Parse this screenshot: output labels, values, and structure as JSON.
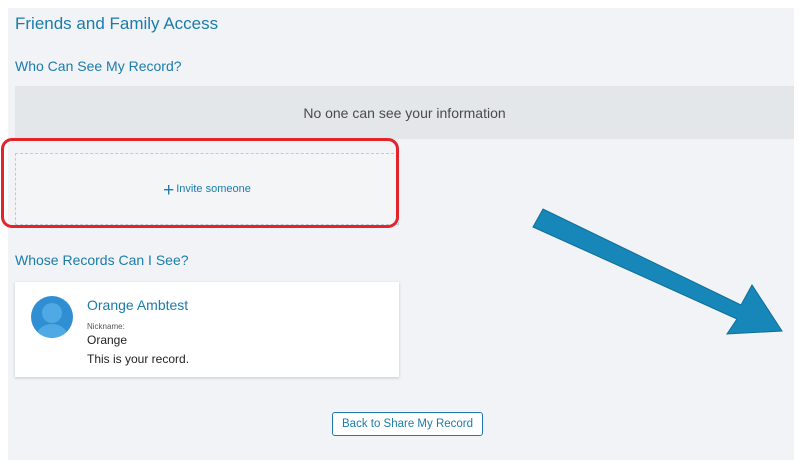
{
  "page": {
    "title": "Friends and Family Access"
  },
  "who_can_see": {
    "heading": "Who Can See My Record?",
    "empty_text": "No one can see your information",
    "invite_icon": "plus-icon",
    "invite_glyph": "+",
    "invite_label": "Invite someone"
  },
  "whose_records": {
    "heading": "Whose Records Can I See?",
    "records": [
      {
        "name": "Orange Ambtest",
        "nickname_label": "Nickname:",
        "nickname": "Orange",
        "note": "This is your record.",
        "avatar_icon": "user-avatar-icon"
      }
    ]
  },
  "footer": {
    "back_label": "Back to Share My Record"
  },
  "colors": {
    "accent": "#1b7cab",
    "highlight_ring": "#e3252b",
    "annotation_arrow": "#1687b8",
    "panel_background": "#f1f3f6",
    "empty_box_background": "#e4e7ea"
  }
}
